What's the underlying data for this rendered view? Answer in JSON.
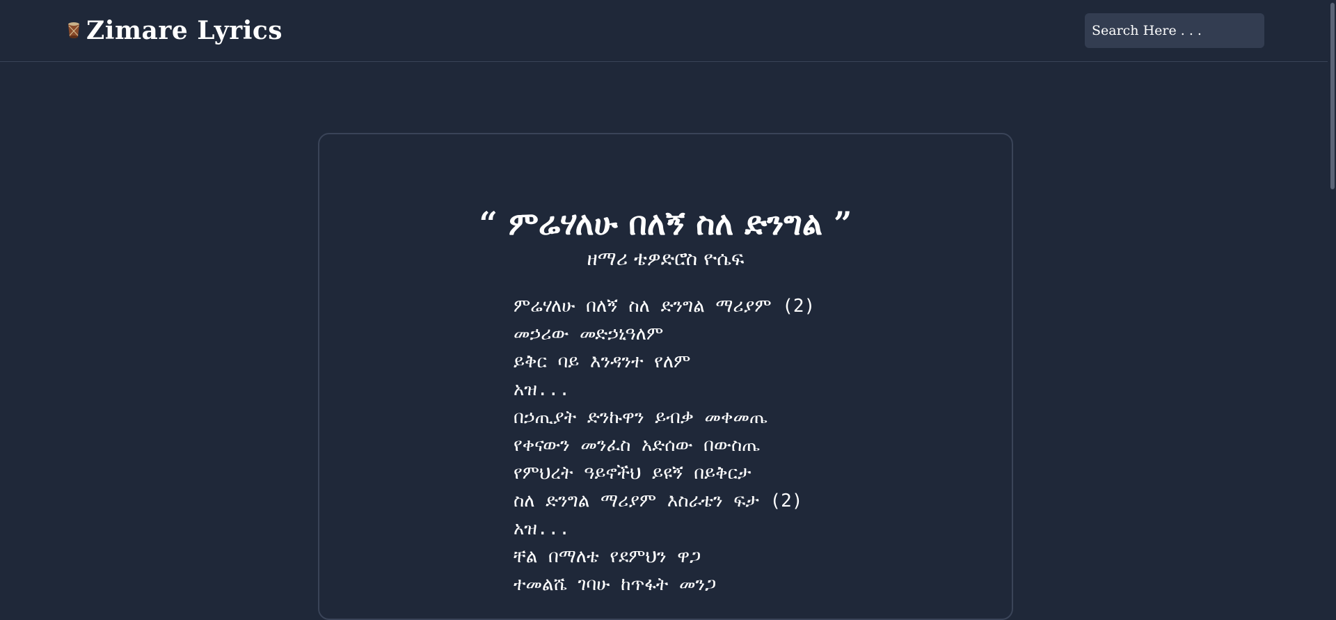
{
  "header": {
    "brand_title": "Zimare Lyrics",
    "logo_icon": "drum-icon",
    "search_placeholder": "Search Here . . ."
  },
  "song": {
    "open_quote": "“",
    "title": "ምሬሃለሁ በለኝ ስለ ድንግል",
    "close_quote": "”",
    "artist": "ዘማሪ ቴዎድሮስ ዮሴፍ",
    "lines": [
      "ምሬሃለሁ በለኝ ስለ ድንግል ማሪያም (2)",
      "መኃሪው መድኃኒዓለም",
      "ይቅር ባይ እንዳንተ የለም",
      "አዝ...",
      "በኃጢያት ድንኩዋን ይብቃ መቀመጤ",
      "የቀናውን መንፈስ አድሰው በውስጤ",
      "የምህረት ዓይኖችህ ይዩኝ በይቅርታ",
      "ስለ ድንግል ማሪያም እስራቴን ፍታ (2)",
      "አዝ...",
      "ቸል በማለቴ የደምህን ዋጋ",
      "ተመልሼ ገባሁ ከጥፋት መንጋ"
    ]
  },
  "colors": {
    "background": "#1f2839",
    "border": "#3a4458",
    "search_bg": "#333d51",
    "text": "#ffffff"
  }
}
